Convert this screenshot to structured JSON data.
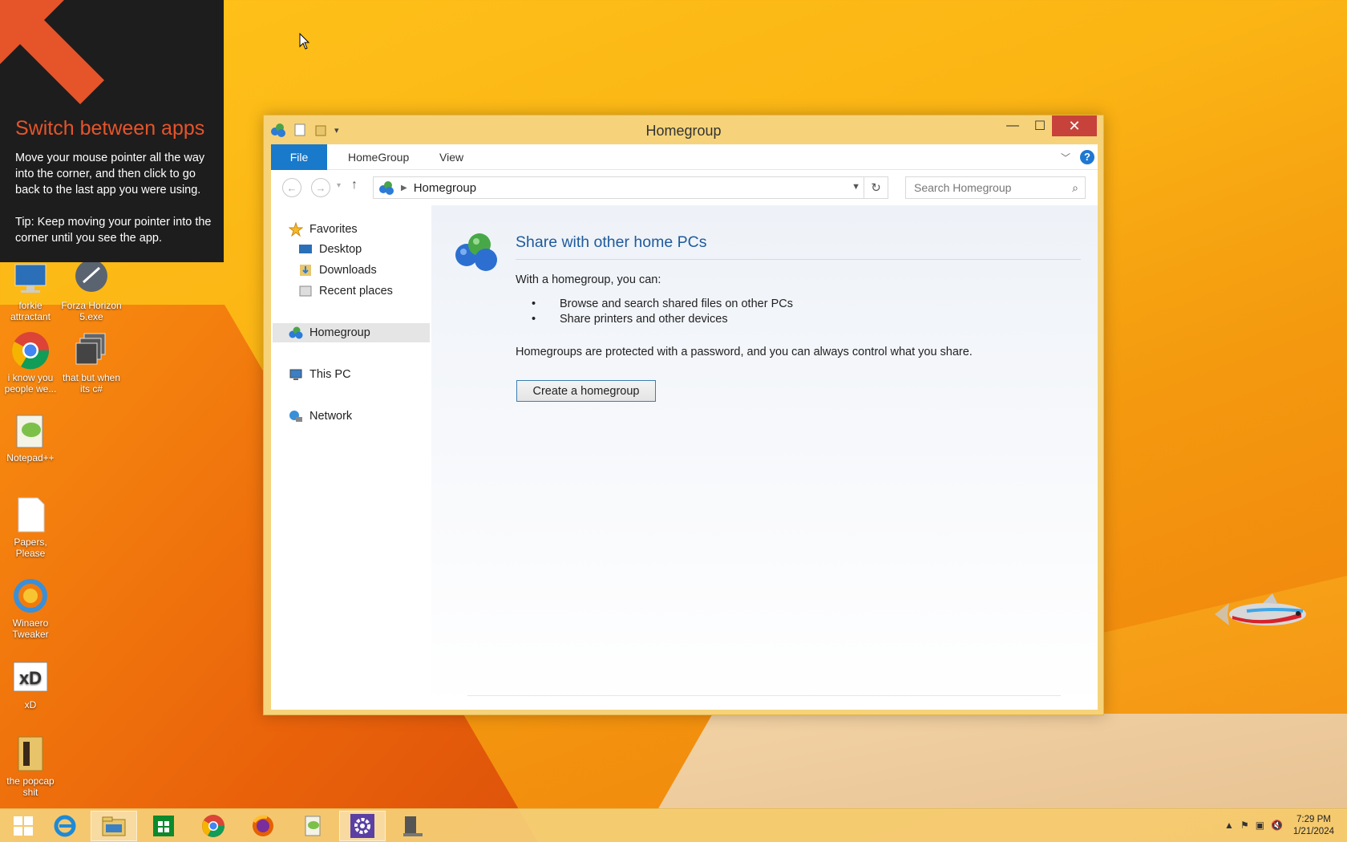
{
  "tip": {
    "title": "Switch between apps",
    "body": "Move your mouse pointer all the way into the corner, and then click to go back to the last app you were using.",
    "tip_text": "Tip: Keep moving your pointer into the corner until you see the app."
  },
  "desktop_icons": [
    {
      "label": "forkie attractant",
      "icon": "computer-icon"
    },
    {
      "label": "Forza Horizon 5.exe",
      "icon": "steam-icon"
    },
    {
      "label": "i know you people we...",
      "icon": "chrome-icon"
    },
    {
      "label": "that but when its c#",
      "icon": "stack-icon"
    },
    {
      "label": "Notepad++",
      "icon": "notepadpp-icon"
    },
    {
      "label": "Papers, Please",
      "icon": "document-icon"
    },
    {
      "label": "Winaero Tweaker",
      "icon": "winaero-icon"
    },
    {
      "label": "xD",
      "icon": "xd-icon"
    },
    {
      "label": "the popcap shit",
      "icon": "folder-icon"
    }
  ],
  "window": {
    "title": "Homegroup",
    "ribbon_tabs": {
      "file": "File",
      "homegroup": "HomeGroup",
      "view": "View"
    },
    "address": {
      "location": "Homegroup"
    },
    "search": {
      "placeholder": "Search Homegroup"
    },
    "nav": {
      "favorites": "Favorites",
      "desktop": "Desktop",
      "downloads": "Downloads",
      "recent": "Recent places",
      "homegroup": "Homegroup",
      "thispc": "This PC",
      "network": "Network"
    },
    "content": {
      "heading": "Share with other home PCs",
      "intro": "With a homegroup, you can:",
      "bullets": [
        "Browse and search shared files on other PCs",
        "Share printers and other devices"
      ],
      "note": "Homegroups are protected with a password, and you can always control what you share.",
      "button": "Create a homegroup"
    }
  },
  "taskbar": {
    "apps": [
      "start-icon",
      "internet-explorer-icon",
      "file-explorer-icon",
      "store-icon",
      "chrome-icon",
      "firefox-icon",
      "notepadpp-icon",
      "settings-icon",
      "document-icon"
    ],
    "clock": {
      "time": "7:29 PM",
      "date": "1/21/2024"
    }
  },
  "colors": {
    "accent": "#1979ca",
    "tip_title": "#e6542a",
    "close": "#c7423a"
  }
}
